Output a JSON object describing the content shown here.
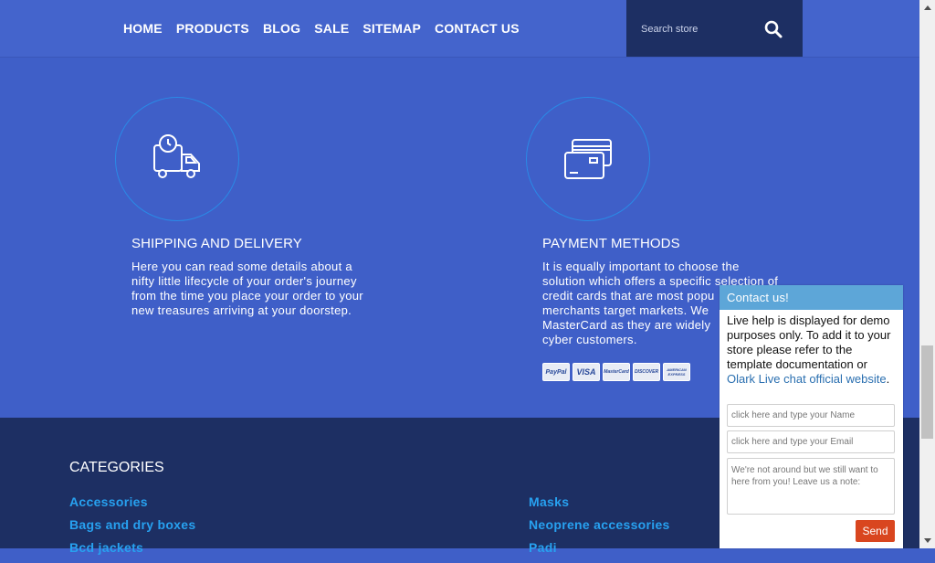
{
  "nav": {
    "items": [
      "HOME",
      "PRODUCTS",
      "BLOG",
      "SALE",
      "SITEMAP",
      "CONTACT US"
    ]
  },
  "search": {
    "placeholder": "Search store"
  },
  "features": {
    "shipping": {
      "title": "SHIPPING AND DELIVERY",
      "lines": [
        "Here you can read some details about a",
        "nifty little lifecycle of your order's journey",
        "from the time you place your order to your",
        "new treasures arriving at your doorstep."
      ],
      "icon": "delivery-truck-clock-icon"
    },
    "payment": {
      "title": "PAYMENT METHODS",
      "lines": [
        "It is equally important to choose the",
        "solution which offers a specific selection of",
        "credit cards that are most popu",
        "merchants target markets. We",
        "MasterCard as they are widely",
        "cyber customers."
      ],
      "icon": "credit-cards-icon",
      "cards": [
        "PayPal",
        "VISA",
        "MasterCard",
        "DISCOVER",
        "AMERICAN EXPRESS"
      ]
    }
  },
  "footer": {
    "categories_title": "CATEGORIES",
    "col1": [
      "Accessories",
      "Bags and dry boxes",
      "Bcd jackets"
    ],
    "col2": [
      "Masks",
      "Neoprene accessories",
      "Padi"
    ]
  },
  "chat": {
    "header": "Contact us!",
    "message": "Live help is displayed for demo purposes only. To add it to your store please refer to the template documentation or ",
    "link": "Olark Live chat official website",
    "link_suffix": ".",
    "name_placeholder": "click here and type your Name",
    "email_placeholder": "click here and type your Email",
    "note_placeholder": "We're not around but we still want to here from you! Leave us a note:",
    "send_label": "Send"
  },
  "colors": {
    "accent": "#4464cc",
    "footer": "#1d2f63",
    "link": "#27a1f0",
    "chat_header": "#5da6d8",
    "send": "#d9461f"
  }
}
